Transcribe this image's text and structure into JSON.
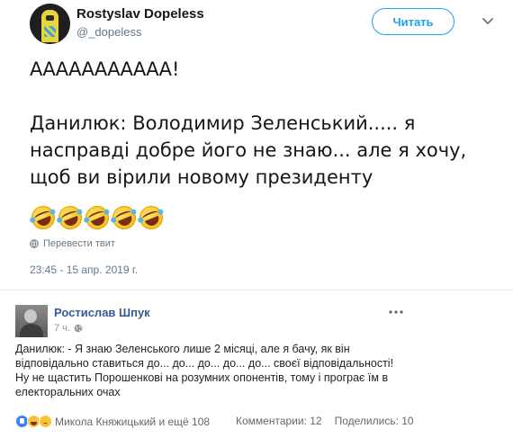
{
  "tweet": {
    "author_name": "Rostyslav Dopeless",
    "author_handle": "@_dopeless",
    "follow_label": "Читать",
    "text_line1": "ААААААААААА!",
    "text_line2": "Данилюк: Володимир Зеленський..... я",
    "text_line3": "насправді добре його не знаю... але я хочу,",
    "text_line4": "щоб ви вірили новому президенту",
    "emoji_icons": [
      "rolling-on-floor-laughing",
      "rolling-on-floor-laughing",
      "rolling-on-floor-laughing",
      "rolling-on-floor-laughing",
      "rolling-on-floor-laughing"
    ],
    "translate_label": "Перевести твит",
    "timestamp": "23:45 - 15 апр. 2019 г.",
    "accent_color": "#1da1f2"
  },
  "fb_post": {
    "author_name": "Ростислав Шпук",
    "time": "7 ч.",
    "text_line1": "Данилюк: - Я знаю Зеленського лише 2 місяці, але я бачу, як він",
    "text_line2": "відповідально ставиться до... до... до... до... до... своєї відповідальності!",
    "text_line3": "Ну не щастить Порошенкові на розумних опонентів, тому і програє їм в",
    "text_line4": "електоральних очах",
    "reactions_text": "Микола Княжицький и ещё 108",
    "reaction_icons": [
      "like",
      "haha",
      "sad"
    ],
    "comments_label": "Комментарии: 12",
    "shares_label": "Поделились: 10",
    "name_color": "#385898"
  }
}
